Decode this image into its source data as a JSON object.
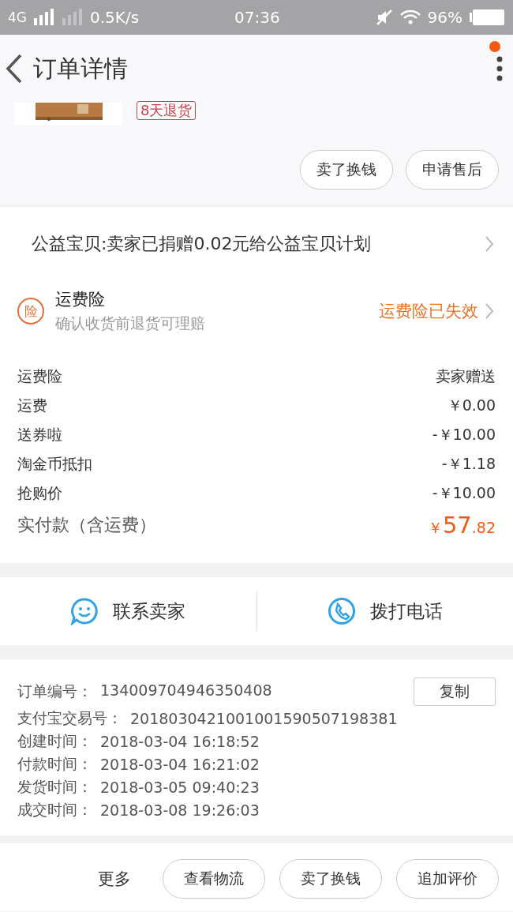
{
  "status_bar": {
    "network": "4G",
    "speed": "0.5K/s",
    "time": "07:36",
    "battery": "96%"
  },
  "header": {
    "title": "订单详情",
    "notification_dot": true
  },
  "product": {
    "tag": "8天退货"
  },
  "item_actions": [
    "卖了换钱",
    "申请售后"
  ],
  "charity": {
    "text": "公益宝贝:卖家已捐赠0.02元给公益宝贝计划"
  },
  "insurance": {
    "badge": "险",
    "title": "运费险",
    "subtitle": "确认收货前退货可理赔",
    "status": "运费险已失效"
  },
  "fees": [
    {
      "label": "运费险",
      "value": "卖家赠送"
    },
    {
      "label": "运费",
      "value": "￥0.00"
    },
    {
      "label": "送券啦",
      "value": "-￥10.00"
    },
    {
      "label": "淘金币抵扣",
      "value": "-￥1.18"
    },
    {
      "label": "抢购价",
      "value": "-￥10.00"
    }
  ],
  "total": {
    "label": "实付款（含运费）",
    "currency": "￥",
    "integer": "57",
    "decimal": ".82"
  },
  "contact": [
    {
      "kind": "chat",
      "label": "联系卖家"
    },
    {
      "kind": "phone",
      "label": "拨打电话"
    }
  ],
  "order_info": {
    "copy_button": "复制",
    "rows": [
      {
        "label": "订单编号：",
        "value": "134009704946350408"
      },
      {
        "label": "支付宝交易号：",
        "value": "2018030421001001590507198381"
      },
      {
        "label": "创建时间：",
        "value": "2018-03-04 16:18:52"
      },
      {
        "label": "付款时间：",
        "value": "2018-03-04 16:21:02"
      },
      {
        "label": "发货时间：",
        "value": "2018-03-05 09:40:23"
      },
      {
        "label": "成交时间：",
        "value": "2018-03-08 19:26:03"
      }
    ]
  },
  "bottom_bar": {
    "more": "更多",
    "buttons": [
      "查看物流",
      "卖了换钱",
      "追加评价"
    ]
  }
}
